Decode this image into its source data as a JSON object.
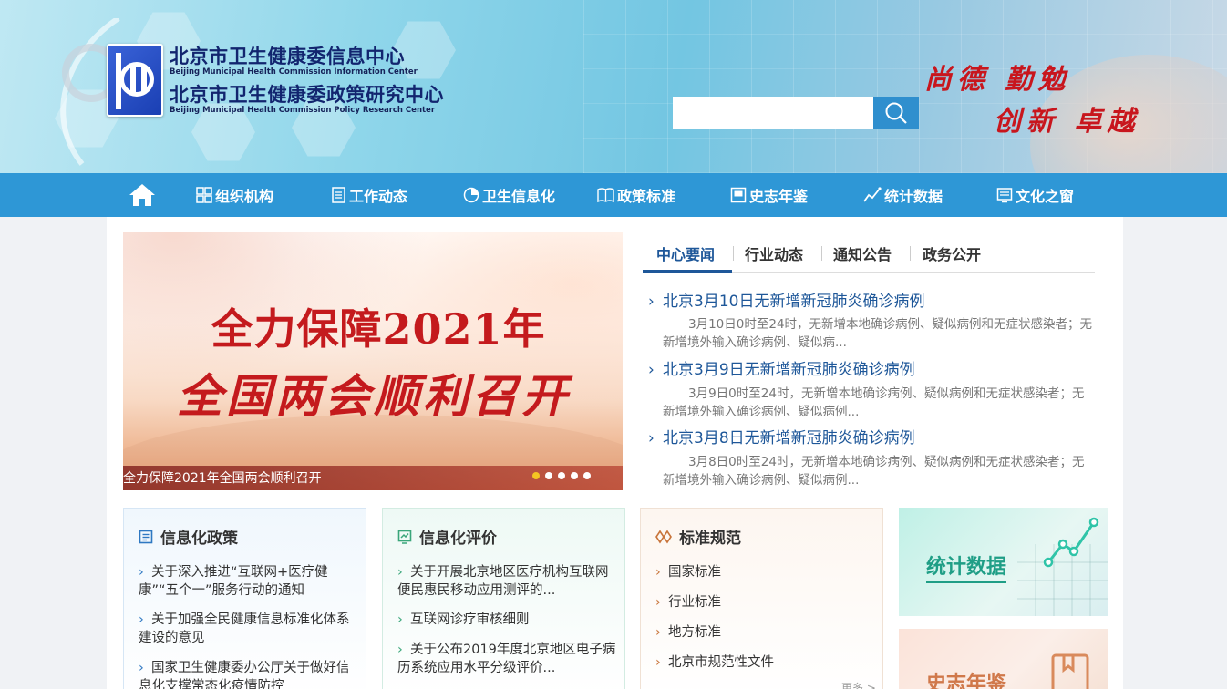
{
  "header": {
    "org_cn_1": "北京市卫生健康委信息中心",
    "org_en_1": "Beijing Municipal Health Commission Information Center",
    "org_cn_2": "北京市卫生健康委政策研究中心",
    "org_en_2": "Beijing Municipal Health Commission Policy Research Center",
    "search_value": "",
    "slogan_1": "尚德 勤勉",
    "slogan_2": "创新 卓越"
  },
  "nav": {
    "items": [
      {
        "label": "组织机构",
        "icon": "grid-icon"
      },
      {
        "label": "工作动态",
        "icon": "document-icon"
      },
      {
        "label": "卫生信息化",
        "icon": "pie-chart-icon"
      },
      {
        "label": "政策标准",
        "icon": "book-icon"
      },
      {
        "label": "史志年鉴",
        "icon": "picture-icon"
      },
      {
        "label": "统计数据",
        "icon": "line-chart-icon"
      },
      {
        "label": "文化之窗",
        "icon": "monitor-icon"
      }
    ]
  },
  "banner": {
    "line1": "全力保障2021年",
    "line2": "全国两会顺利召开",
    "caption": "全力保障2021年全国两会顺利召开",
    "slide_count": 5,
    "active_slide": 0
  },
  "news": {
    "tabs": [
      "中心要闻",
      "行业动态",
      "通知公告",
      "政务公开"
    ],
    "active_tab": 0,
    "items": [
      {
        "title": "北京3月10日无新增新冠肺炎确诊病例",
        "desc": "3月10日0时至24时，无新增本地确诊病例、疑似病例和无症状感染者；无新增境外输入确诊病例、疑似病..."
      },
      {
        "title": "北京3月9日无新增新冠肺炎确诊病例",
        "desc": "3月9日0时至24时，无新增本地确诊病例、疑似病例和无症状感染者；无新增境外输入确诊病例、疑似病例..."
      },
      {
        "title": "北京3月8日无新增新冠肺炎确诊病例",
        "desc": "3月8日0时至24时，无新增本地确诊病例、疑似病例和无症状感染者；无新增境外输入确诊病例、疑似病例..."
      }
    ]
  },
  "cards": {
    "policy": {
      "title": "信息化政策",
      "links": [
        "关于深入推进“互联网+医疗健康”“五个一”服务行动的通知",
        "关于加强全民健康信息标准化体系建设的意见",
        "国家卫生健康委办公厅关于做好信息化支撑常态化疫情防控"
      ]
    },
    "evaluation": {
      "title": "信息化评价",
      "links": [
        "关于开展北京地区医疗机构互联网便民惠民移动应用测评的...",
        "互联网诊疗审核细则",
        "关于公布2019年度北京地区电子病历系统应用水平分级评价..."
      ]
    },
    "standards": {
      "title": "标准规范",
      "links": [
        "国家标准",
        "行业标准",
        "地方标准",
        "北京市规范性文件"
      ],
      "more": "更多 >"
    }
  },
  "promos": {
    "stats": "统计数据",
    "yearbook": "史志年鉴"
  },
  "colors": {
    "nav_bg": "#2e97d6",
    "link_blue": "#1e5799",
    "slogan_red": "#c8161d",
    "banner_red": "#c41a1d"
  }
}
